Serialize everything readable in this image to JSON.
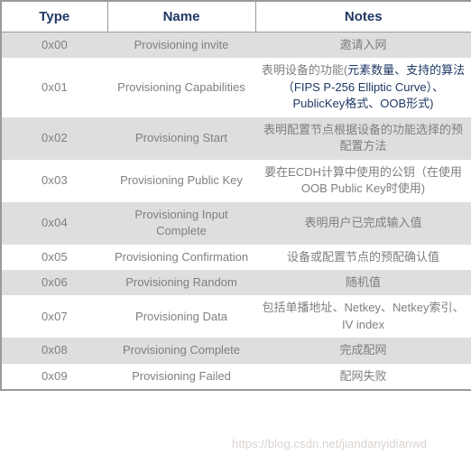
{
  "table": {
    "headers": [
      "Type",
      "Name",
      "Notes"
    ],
    "rows": [
      {
        "type": "0x00",
        "name": "Provisioning invite",
        "notes": "邀请入网",
        "notes_highlight": "",
        "shaded": true
      },
      {
        "type": "0x01",
        "name": "Provisioning Capabilities",
        "notes": "表明设备的功能(",
        "notes_highlight": "元素数量、支持的算法（FIPS P-256 Elliptic Curve）、PublicKey格式、OOB形式)",
        "shaded": false
      },
      {
        "type": "0x02",
        "name": "Provisioning Start",
        "notes": "表明配置节点根据设备的功能选择的预配置方法",
        "notes_highlight": "",
        "shaded": true
      },
      {
        "type": "0x03",
        "name": "Provisioning Public Key",
        "notes": "要在ECDH计算中使用的公钥（在使用OOB Public Key时使用)",
        "notes_highlight": "",
        "shaded": false
      },
      {
        "type": "0x04",
        "name": "Provisioning Input Complete",
        "notes": "表明用户已完成输入值",
        "notes_highlight": "",
        "shaded": true
      },
      {
        "type": "0x05",
        "name": "Provisioning Confirmation",
        "notes": "设备或配置节点的预配确认值",
        "notes_highlight": "",
        "shaded": false
      },
      {
        "type": "0x06",
        "name": "Provisioning Random",
        "notes": "随机值",
        "notes_highlight": "",
        "shaded": true
      },
      {
        "type": "0x07",
        "name": "Provisioning Data",
        "notes": "包括单播地址、Netkey、Netkey索引、IV index",
        "notes_highlight": "",
        "shaded": false
      },
      {
        "type": "0x08",
        "name": "Provisioning Complete",
        "notes": "完成配网",
        "notes_highlight": "",
        "shaded": true
      },
      {
        "type": "0x09",
        "name": "Provisioning Failed",
        "notes": "配网失败",
        "notes_highlight": "",
        "shaded": false
      }
    ]
  },
  "watermark": {
    "text": "https://blog.csdn.net/jiandanyidianwd"
  },
  "colors": {
    "header_text": "#1f3864",
    "body_text": "#7f7f7f",
    "row_shaded": "#dedede",
    "row_plain": "#ffffff",
    "border": "#9a9a9a",
    "highlight_text": "#1f3864",
    "watermark_text": "#d9d3cf"
  }
}
